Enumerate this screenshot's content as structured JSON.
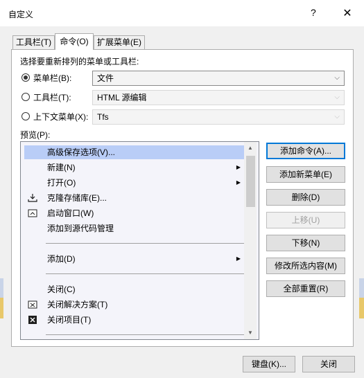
{
  "window": {
    "title": "自定义",
    "help_glyph": "?",
    "close_glyph": "✕"
  },
  "tabs": [
    {
      "label": "工具栏(T)",
      "active": false
    },
    {
      "label": "命令(O)",
      "active": true
    },
    {
      "label": "扩展菜单(E)",
      "active": false
    }
  ],
  "choose_label": "选择要重新排列的菜单或工具栏:",
  "options": [
    {
      "label": "菜单栏(B):",
      "checked": true,
      "value": "文件",
      "enabled": true
    },
    {
      "label": "工具栏(T):",
      "checked": false,
      "value": "HTML 源编辑",
      "enabled": false
    },
    {
      "label": "上下文菜单(X):",
      "checked": false,
      "value": "Tfs",
      "enabled": false
    }
  ],
  "preview_label": "预览(P):",
  "preview_items": [
    {
      "label": "高级保存选项(V)...",
      "icon": "",
      "submenu": false,
      "selected": true
    },
    {
      "label": "新建(N)",
      "icon": "",
      "submenu": true,
      "selected": false
    },
    {
      "label": "打开(O)",
      "icon": "",
      "submenu": true,
      "selected": false
    },
    {
      "label": "克隆存储库(E)...",
      "icon": "clone-icon",
      "submenu": false,
      "selected": false
    },
    {
      "label": "启动窗口(W)",
      "icon": "start-window-icon",
      "submenu": false,
      "selected": false
    },
    {
      "label": "添加到源代码管理",
      "icon": "",
      "submenu": false,
      "selected": false
    },
    {
      "label": "添加(D)",
      "icon": "",
      "submenu": true,
      "selected": false
    },
    {
      "label": "关闭(C)",
      "icon": "",
      "submenu": false,
      "selected": false
    },
    {
      "label": "关闭解决方案(T)",
      "icon": "close-solution-icon",
      "submenu": false,
      "selected": false
    },
    {
      "label": "关闭项目(T)",
      "icon": "close-project-icon",
      "submenu": false,
      "selected": false
    }
  ],
  "buttons": {
    "add_command": "添加命令(A)...",
    "add_menu": "添加新菜单(E)",
    "delete": "删除(D)",
    "move_up": "上移(U)",
    "move_down": "下移(N)",
    "modify": "修改所选内容(M)",
    "reset_all": "全部重置(R)",
    "keyboard": "键盘(K)...",
    "close": "关闭"
  },
  "colors": {
    "selection": "#b9cdf7",
    "default_button_border": "#0078d7"
  }
}
